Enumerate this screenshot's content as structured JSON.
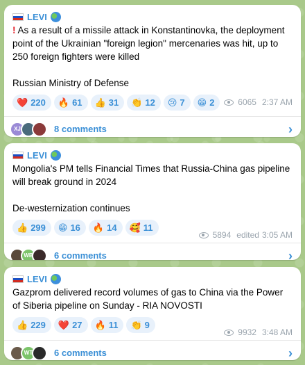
{
  "posts": [
    {
      "sender": "LEVI",
      "paragraphs": [
        "As a result of a missile attack in Konstantinovka, the deployment point of the Ukrainian \"foreign legion\" mercenaries was hit, up to 250 foreign fighters were killed",
        "Russian Ministry of Defense"
      ],
      "reactions": [
        {
          "emoji": "❤️",
          "count": "220"
        },
        {
          "emoji": "🔥",
          "count": "61"
        },
        {
          "emoji": "👍",
          "count": "31"
        },
        {
          "emoji": "👏",
          "count": "12"
        },
        {
          "emoji": "😢",
          "count": "7"
        },
        {
          "emoji": "😁",
          "count": "2"
        }
      ],
      "views": "6065",
      "time": "2:37 AM",
      "edited": "",
      "comments": "8 comments",
      "avatars": [
        {
          "initials": "XJ",
          "color": "#9a8ad6"
        },
        {
          "initials": "",
          "color": "#4a6b7c"
        },
        {
          "initials": "",
          "color": "#8b3a3a"
        }
      ]
    },
    {
      "sender": "LEVI",
      "paragraphs": [
        "Mongolia's PM tells Financial Times that Russia-China gas pipeline will break ground in 2024",
        "De-westernization continues"
      ],
      "reactions": [
        {
          "emoji": "👍",
          "count": "299"
        },
        {
          "emoji": "😁",
          "count": "16"
        },
        {
          "emoji": "🔥",
          "count": "14"
        },
        {
          "emoji": "🥰",
          "count": "11"
        }
      ],
      "views": "5894",
      "time": "3:05 AM",
      "edited": "edited",
      "comments": "6 comments",
      "avatars": [
        {
          "initials": "",
          "color": "#5a4a3a"
        },
        {
          "initials": "WB",
          "color": "#7cc46a"
        },
        {
          "initials": "",
          "color": "#3a2a2a"
        }
      ]
    },
    {
      "sender": "LEVI",
      "paragraphs": [
        "Gazprom delivered record volumes of gas to China via the Power of Siberia pipeline on Sunday - RIA NOVOSTI"
      ],
      "reactions": [
        {
          "emoji": "👍",
          "count": "229"
        },
        {
          "emoji": "❤️",
          "count": "27"
        },
        {
          "emoji": "🔥",
          "count": "11"
        },
        {
          "emoji": "👏",
          "count": "9"
        }
      ],
      "views": "9932",
      "time": "3:48 AM",
      "edited": "",
      "comments": "6 comments",
      "avatars": [
        {
          "initials": "",
          "color": "#6a5a4a"
        },
        {
          "initials": "WT",
          "color": "#7cc46a"
        },
        {
          "initials": "",
          "color": "#2a2a2a"
        }
      ]
    }
  ]
}
